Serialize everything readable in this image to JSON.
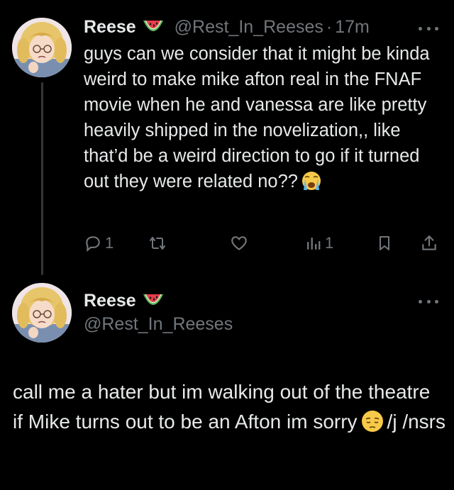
{
  "colors": {
    "background": "#000000",
    "text_primary": "#e7e9ea",
    "text_secondary": "#71767b",
    "thread_line": "#333639"
  },
  "tweet1": {
    "author": {
      "display_name": "Reese",
      "handle": "@Rest_In_Reeses",
      "name_emoji": "watermelon-emoji"
    },
    "separator": "·",
    "timestamp": "17m",
    "text": "guys can we consider that it might be kinda weird to make mike afton real in the FNAF movie when he and vanessa are like pretty heavily shipped in the novelization,, like that’d be a weird direction to go if it turned out they were related no??",
    "text_emoji": "loudly-crying-face-emoji",
    "actions": {
      "reply_icon": "reply-icon",
      "reply_count": "1",
      "retweet_icon": "retweet-icon",
      "like_icon": "heart-icon",
      "views_icon": "views-bar-chart-icon",
      "views_count": "1",
      "bookmark_icon": "bookmark-icon",
      "share_icon": "share-icon"
    }
  },
  "tweet2": {
    "author": {
      "display_name": "Reese",
      "handle": "@Rest_In_Reeses",
      "name_emoji": "watermelon-emoji"
    },
    "text_before": "call me a hater but im walking out of the theatre if Mike turns out to be an Afton im sorry",
    "text_emoji": "pensive-face-emoji",
    "text_after": "/j /nsrs"
  }
}
